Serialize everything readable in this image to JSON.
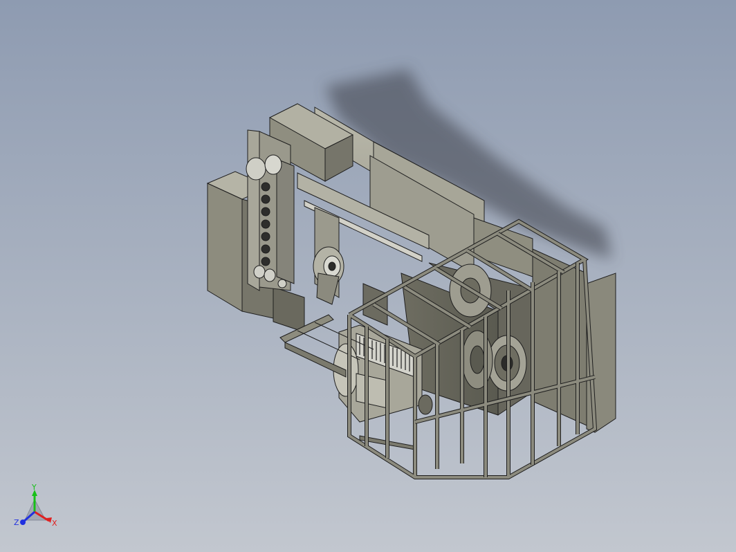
{
  "viewport": {
    "background_top": "#8e9bb1",
    "background_bottom": "#c2c7cf"
  },
  "model": {
    "body_color": "#8d8c7d",
    "frame_color": "#7d7c6e",
    "edge_color": "#1e1e1e",
    "shadow_color": "#3c3f48"
  },
  "triad": {
    "x_label": "X",
    "y_label": "Y",
    "z_label": "Z",
    "x_color": "#e02020",
    "y_color": "#18c018",
    "z_color": "#2030e0"
  }
}
